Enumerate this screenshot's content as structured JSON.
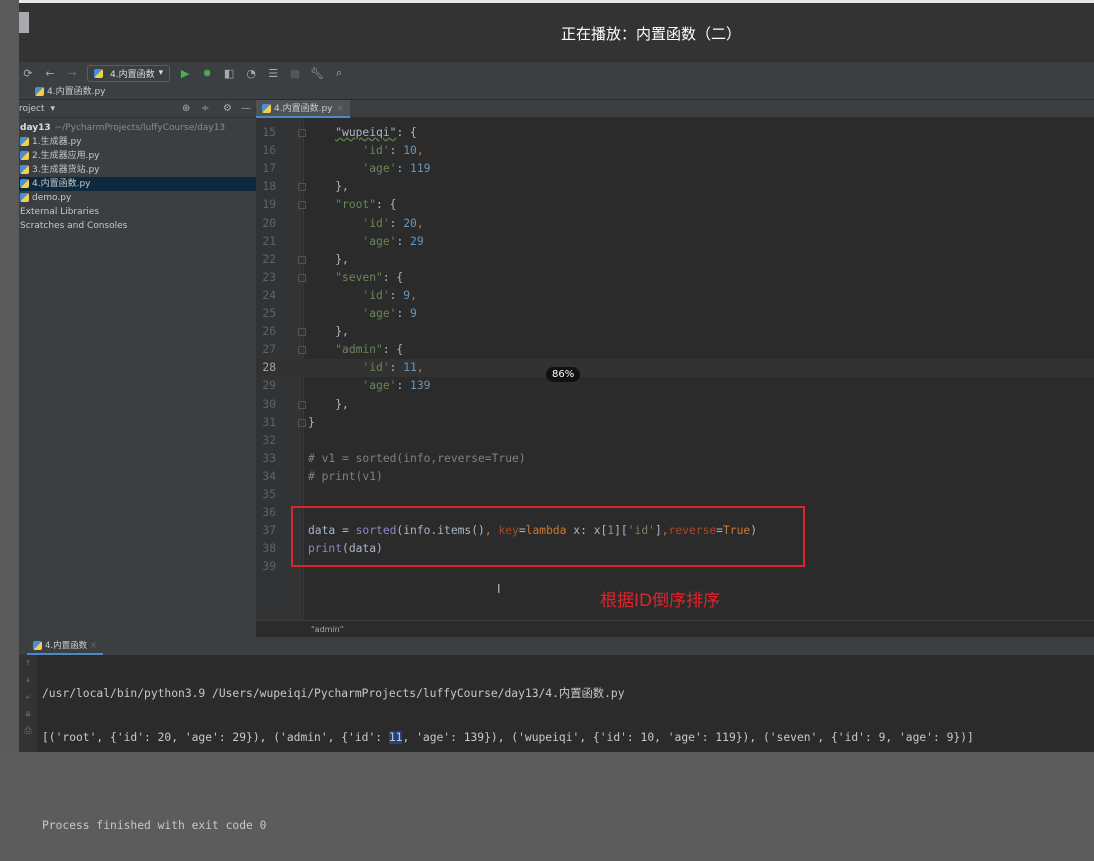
{
  "player": {
    "title": "正在播放：内置函数（二）"
  },
  "toolbar": {
    "run_config": "4.内置函数"
  },
  "breadcrumb": "4.内置函数.py",
  "project": {
    "header": "roject",
    "root": "day13",
    "root_path": "~/PycharmProjects/luffyCourse/day13",
    "files": [
      "1.生成器.py",
      "2.生成器应用.py",
      "3.生成器货站.py",
      "4.内置函数.py",
      "demo.py"
    ],
    "extra": [
      "External Libraries",
      "Scratches and Consoles"
    ]
  },
  "editor": {
    "tab": "4.内置函数.py",
    "current_line": 28,
    "lines": [
      {
        "n": 15,
        "t": [
          [
            "    ",
            ""
          ],
          [
            "\"wupeiqi\"",
            "sq"
          ],
          [
            ": {",
            ""
          ]
        ]
      },
      {
        "n": 16,
        "t": [
          [
            "        ",
            ""
          ],
          [
            "'id'",
            "s"
          ],
          [
            ": ",
            ""
          ],
          [
            "10",
            "n"
          ],
          [
            ",",
            "k"
          ]
        ]
      },
      {
        "n": 17,
        "t": [
          [
            "        ",
            ""
          ],
          [
            "'age'",
            "s"
          ],
          [
            ": ",
            ""
          ],
          [
            "119",
            "n"
          ]
        ]
      },
      {
        "n": 18,
        "t": [
          [
            "    },",
            ""
          ]
        ]
      },
      {
        "n": 19,
        "t": [
          [
            "    ",
            ""
          ],
          [
            "\"root\"",
            "s"
          ],
          [
            ": {",
            ""
          ]
        ]
      },
      {
        "n": 20,
        "t": [
          [
            "        ",
            ""
          ],
          [
            "'id'",
            "s"
          ],
          [
            ": ",
            ""
          ],
          [
            "20",
            "n"
          ],
          [
            ",",
            "k"
          ]
        ]
      },
      {
        "n": 21,
        "t": [
          [
            "        ",
            ""
          ],
          [
            "'age'",
            "s"
          ],
          [
            ": ",
            ""
          ],
          [
            "29",
            "n"
          ]
        ]
      },
      {
        "n": 22,
        "t": [
          [
            "    },",
            ""
          ]
        ]
      },
      {
        "n": 23,
        "t": [
          [
            "    ",
            ""
          ],
          [
            "\"seven\"",
            "s"
          ],
          [
            ": {",
            ""
          ]
        ]
      },
      {
        "n": 24,
        "t": [
          [
            "        ",
            ""
          ],
          [
            "'id'",
            "s"
          ],
          [
            ": ",
            ""
          ],
          [
            "9",
            "n"
          ],
          [
            ",",
            "k"
          ]
        ]
      },
      {
        "n": 25,
        "t": [
          [
            "        ",
            ""
          ],
          [
            "'age'",
            "s"
          ],
          [
            ": ",
            ""
          ],
          [
            "9",
            "n"
          ]
        ]
      },
      {
        "n": 26,
        "t": [
          [
            "    },",
            ""
          ]
        ]
      },
      {
        "n": 27,
        "t": [
          [
            "    ",
            ""
          ],
          [
            "\"admin\"",
            "s"
          ],
          [
            ": {",
            ""
          ]
        ]
      },
      {
        "n": 28,
        "t": [
          [
            "        ",
            ""
          ],
          [
            "'id'",
            "s"
          ],
          [
            ": ",
            ""
          ],
          [
            "11",
            "n"
          ],
          [
            ",",
            "k"
          ]
        ]
      },
      {
        "n": 29,
        "t": [
          [
            "        ",
            ""
          ],
          [
            "'age'",
            "s"
          ],
          [
            ": ",
            ""
          ],
          [
            "139",
            "n"
          ]
        ]
      },
      {
        "n": 30,
        "t": [
          [
            "    },",
            ""
          ]
        ]
      },
      {
        "n": 31,
        "t": [
          [
            "}",
            ""
          ]
        ]
      },
      {
        "n": 32,
        "t": []
      },
      {
        "n": 33,
        "t": [
          [
            "# v1 = sorted(info,reverse=True)",
            "c"
          ]
        ]
      },
      {
        "n": 34,
        "t": [
          [
            "# print(v1)",
            "c"
          ]
        ]
      },
      {
        "n": 35,
        "t": []
      },
      {
        "n": 36,
        "t": []
      },
      {
        "n": 37,
        "t": [
          [
            "data = ",
            ""
          ],
          [
            "sorted",
            "f"
          ],
          [
            "(info.items()",
            ""
          ],
          [
            ", ",
            "k"
          ],
          [
            "key",
            "kw"
          ],
          [
            "=",
            ""
          ],
          [
            "lambda",
            "k"
          ],
          [
            " x: x[",
            ""
          ],
          [
            "1",
            "n"
          ],
          [
            "][",
            ""
          ],
          [
            "'id'",
            "s"
          ],
          [
            "]",
            ""
          ],
          [
            ",",
            "k"
          ],
          [
            "reverse",
            "kw"
          ],
          [
            "=",
            ""
          ],
          [
            "True",
            "k"
          ],
          [
            ")",
            ""
          ]
        ]
      },
      {
        "n": 38,
        "t": [
          [
            "print",
            "f"
          ],
          [
            "(data)",
            ""
          ]
        ]
      },
      {
        "n": 39,
        "t": []
      }
    ],
    "zoom_badge": "86%",
    "annotation": "根据ID倒序排序",
    "status_crumb": "\"admin\""
  },
  "run": {
    "tab": "4.内置函数",
    "cmd": "/usr/local/bin/python3.9 /Users/wupeiqi/PycharmProjects/luffyCourse/day13/4.内置函数.py",
    "out_pre": "[('root', {'id': 20, 'age': 29}), ('admin', {'id': ",
    "out_hl": "11",
    "out_post": ", 'age': 139}), ('wupeiqi', {'id': 10, 'age': 119}), ('seven', {'id': 9, 'age': 9})]",
    "exit": "Process finished with exit code 0"
  }
}
